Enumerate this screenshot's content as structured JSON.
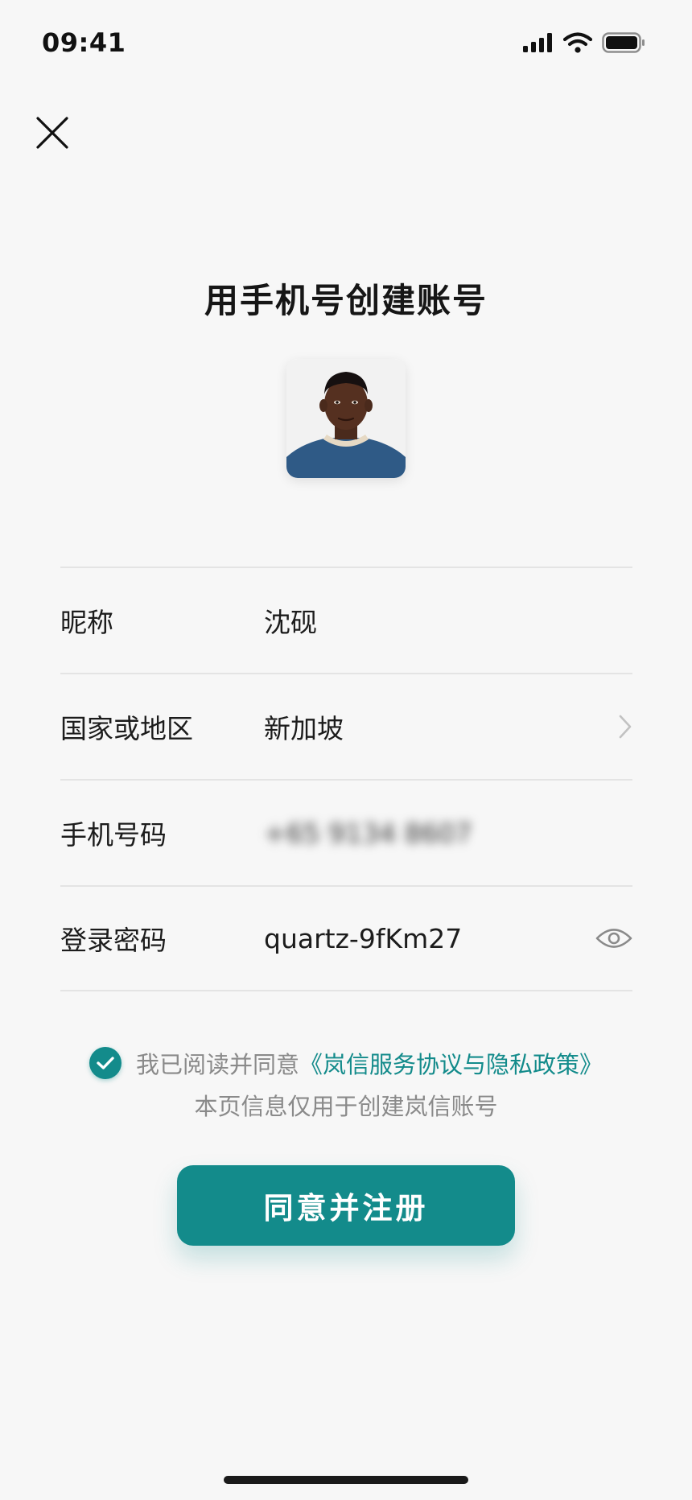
{
  "status_bar": {
    "time": "09:41"
  },
  "header": {
    "title": "用手机号创建账号"
  },
  "form": {
    "rows": [
      {
        "label": "昵称",
        "value": "沈砚"
      },
      {
        "label": "国家或地区",
        "value": "新加坡"
      },
      {
        "label": "手机号码",
        "value": "+65 9134 8607"
      },
      {
        "label": "登录密码",
        "value": "quartz-9fKm27"
      }
    ]
  },
  "agreement": {
    "prefix": "我已阅读并同意",
    "link": "《岚信服务协议与隐私政策》",
    "note": "本页信息仅用于创建岚信账号",
    "checked": true
  },
  "primary_button": {
    "label": "同意并注册"
  },
  "colors": {
    "accent": "#138b8b",
    "background": "#f7f7f7",
    "divider": "#e4e4e4"
  },
  "icons": {
    "close": "close-icon",
    "chevron": "chevron-right-icon",
    "eye": "eye-icon",
    "check": "check-icon",
    "signal": "signal-icon",
    "wifi": "wifi-icon",
    "battery": "battery-icon"
  }
}
